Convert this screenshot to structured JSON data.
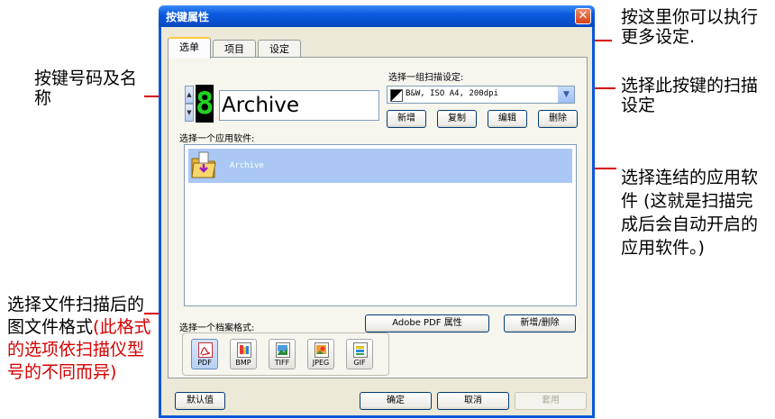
{
  "window": {
    "title": "按键属性",
    "close_glyph": "✕"
  },
  "tabs": [
    {
      "label": "选单"
    },
    {
      "label": "项目"
    },
    {
      "label": "设定"
    }
  ],
  "button_panel": {
    "number": "8",
    "spin_up": "▲",
    "spin_down": "▼",
    "name": "Archive"
  },
  "scan_settings": {
    "label": "选择一组扫描设定:",
    "selected": "B&W, ISO A4, 200dpi",
    "buttons": {
      "new": "新增",
      "copy": "复制",
      "edit": "编辑",
      "delete": "删除"
    }
  },
  "app_section": {
    "label": "选择一个应用软件:",
    "items": [
      {
        "name": "Archive",
        "icon": "folder-download-icon"
      }
    ]
  },
  "format_section": {
    "label": "选择一个档案格式:",
    "pdf_props_button": "Adobe PDF 属性",
    "add_remove_button": "新增/删除",
    "formats": [
      {
        "label": "PDF",
        "icon": "pdf-icon",
        "selected": true
      },
      {
        "label": "BMP",
        "icon": "bmp-icon",
        "selected": false
      },
      {
        "label": "TIFF",
        "icon": "tiff-icon",
        "selected": false
      },
      {
        "label": "JPEG",
        "icon": "jpeg-icon",
        "selected": false
      },
      {
        "label": "GIF",
        "icon": "gif-icon",
        "selected": false
      }
    ]
  },
  "footer": {
    "defaults": "默认值",
    "ok": "确定",
    "cancel": "取消",
    "apply": "套用"
  },
  "callouts": {
    "top_right": "按这里你可以执行更多设定.",
    "left_top": "按键号码及名称",
    "right_scan": "选择此按键的扫描设定",
    "right_app": "选择连结的应用软件 (这就是扫描完成后会自动开启的应用软件。)",
    "left_bottom_black": "选择文件扫描后的图文件格",
    "left_bottom_red": "(此格式的选项依扫描仪型号的不同而异)"
  },
  "colors": {
    "accent_red": "#d80000",
    "lcd_green": "#1fd31f",
    "selection_blue": "#aac8f3"
  }
}
